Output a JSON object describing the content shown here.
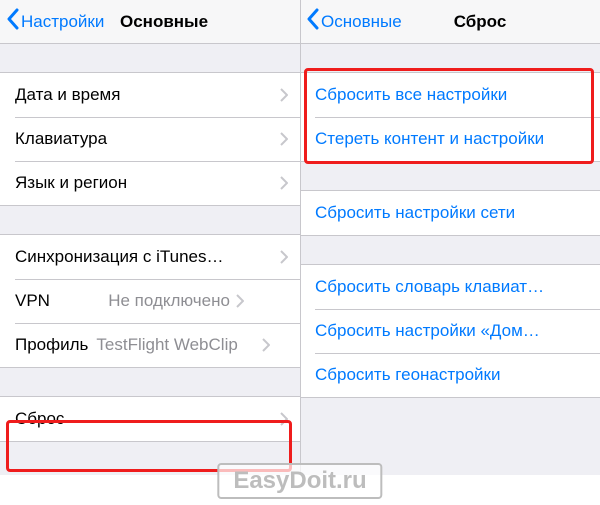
{
  "left": {
    "nav": {
      "back": "Настройки",
      "title": "Основные"
    },
    "group1": [
      {
        "label": "Дата и время"
      },
      {
        "label": "Клавиатура"
      },
      {
        "label": "Язык и регион"
      }
    ],
    "group2": [
      {
        "label": "Синхронизация с iTunes…"
      },
      {
        "label": "VPN",
        "value": "Не подключено"
      },
      {
        "label": "Профиль",
        "value": "TestFlight WebClip"
      }
    ],
    "group3": [
      {
        "label": "Сброс"
      }
    ]
  },
  "right": {
    "nav": {
      "back": "Основные",
      "title": "Сброс"
    },
    "group1": [
      {
        "label": "Сбросить все настройки"
      },
      {
        "label": "Стереть контент и настройки"
      }
    ],
    "group2": [
      {
        "label": "Сбросить настройки сети"
      }
    ],
    "group3": [
      {
        "label": "Сбросить словарь клавиат…"
      },
      {
        "label": "Сбросить настройки «Дом…"
      },
      {
        "label": "Сбросить геонастройки"
      }
    ]
  },
  "watermark": "EasyDoit.ru"
}
